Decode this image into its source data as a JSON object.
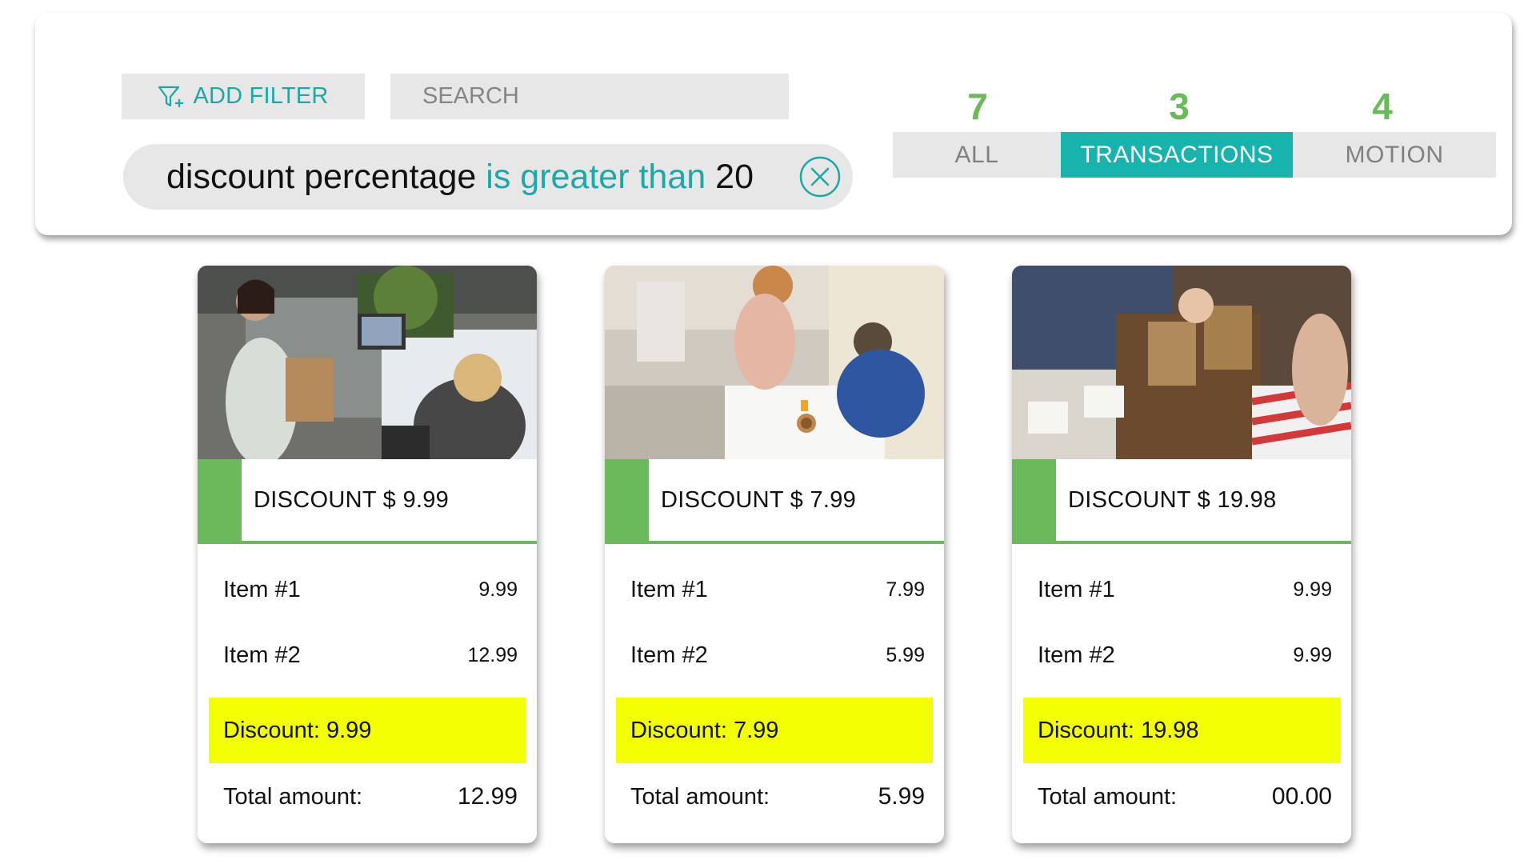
{
  "toolbar": {
    "add_filter_label": "ADD FILTER",
    "search_placeholder": "SEARCH"
  },
  "active_filter": {
    "field": "discount percentage",
    "operator": "is greater than",
    "value": "20"
  },
  "tabs": [
    {
      "label": "ALL",
      "count": "7",
      "active": false
    },
    {
      "label": "TRANSACTIONS",
      "count": "3",
      "active": true
    },
    {
      "label": "MOTION",
      "count": "4",
      "active": false
    }
  ],
  "colors": {
    "accent_teal": "#17b3ac",
    "accent_green": "#6ab95b",
    "highlight_yellow": "#f2ff00",
    "panel_gray": "#e7e7e7"
  },
  "cards": [
    {
      "image_icon": "retail-checkout-photo",
      "title": "DISCOUNT $ 9.99",
      "items": [
        {
          "label": "Item #1",
          "amount": "9.99"
        },
        {
          "label": "Item #2",
          "amount": "12.99"
        }
      ],
      "discount_text": "Discount: 9.99",
      "total_label": "Total amount:",
      "total_value": "12.99"
    },
    {
      "image_icon": "cafe-payment-photo",
      "title": "DISCOUNT $ 7.99",
      "items": [
        {
          "label": "Item #1",
          "amount": "7.99"
        },
        {
          "label": "Item #2",
          "amount": "5.99"
        }
      ],
      "discount_text": "Discount: 7.99",
      "total_label": "Total amount:",
      "total_value": "5.99"
    },
    {
      "image_icon": "takeaway-counter-photo",
      "title": "DISCOUNT $ 19.98",
      "items": [
        {
          "label": "Item #1",
          "amount": "9.99"
        },
        {
          "label": "Item #2",
          "amount": "9.99"
        }
      ],
      "discount_text": "Discount: 19.98",
      "total_label": "Total amount:",
      "total_value": "00.00"
    }
  ]
}
